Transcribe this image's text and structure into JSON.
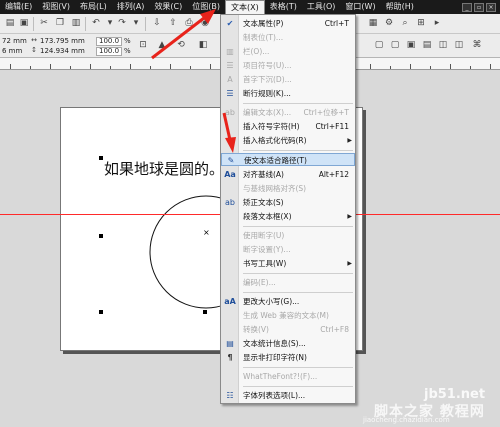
{
  "menubar": {
    "items": [
      "编辑(E)",
      "视图(V)",
      "布局(L)",
      "排列(A)",
      "效果(C)",
      "位图(B)",
      "文本(X)",
      "表格(T)",
      "工具(O)",
      "窗口(W)",
      "帮助(H)"
    ],
    "active_index": 6
  },
  "properties": {
    "pos1": "72 mm",
    "pos2": "6 mm",
    "size1": "173.795 mm",
    "size2": "124.934 mm",
    "scale1": "100.0",
    "scale2": "100.0",
    "unit": "%"
  },
  "canvas": {
    "text": "如果地球是圆的。"
  },
  "text_menu": {
    "items": [
      {
        "label": "文本属性(P)",
        "shortcut": "Ctrl+T",
        "icon": "check-icon",
        "disabled": false
      },
      {
        "label": "制表位(T)...",
        "shortcut": "",
        "icon": "",
        "disabled": true
      },
      {
        "label": "栏(O)...",
        "shortcut": "",
        "icon": "",
        "disabled": true
      },
      {
        "label": "项目符号(U)...",
        "shortcut": "",
        "icon": "",
        "disabled": true
      },
      {
        "label": "首字下沉(D)...",
        "shortcut": "",
        "icon": "",
        "disabled": true
      },
      {
        "label": "断行规则(K)...",
        "shortcut": "",
        "icon": "list-icon",
        "disabled": false
      },
      {
        "label": "编辑文本(X)...",
        "shortcut": "Ctrl+位移+T",
        "icon": "edit-text-icon",
        "disabled": true
      },
      {
        "label": "插入符号字符(H)",
        "shortcut": "Ctrl+F11",
        "icon": "",
        "disabled": false
      },
      {
        "label": "插入格式化代码(R)",
        "shortcut": "",
        "icon": "",
        "disabled": false,
        "submenu": true
      },
      {
        "label": "使文本适合路径(T)",
        "shortcut": "",
        "icon": "fit-text-path-icon",
        "disabled": false,
        "highlight": true
      },
      {
        "label": "对齐基线(A)",
        "shortcut": "Alt+F12",
        "icon": "align-baseline-icon",
        "disabled": false
      },
      {
        "label": "与基线网格对齐(S)",
        "shortcut": "",
        "icon": "",
        "disabled": true
      },
      {
        "label": "矫正文本(S)",
        "shortcut": "",
        "icon": "straighten-text-icon",
        "disabled": false
      },
      {
        "label": "段落文本框(X)",
        "shortcut": "",
        "icon": "",
        "disabled": false,
        "submenu": true
      },
      {
        "label": "使用断字(U)",
        "shortcut": "",
        "icon": "",
        "disabled": true
      },
      {
        "label": "断字设置(Y)...",
        "shortcut": "",
        "icon": "",
        "disabled": true
      },
      {
        "label": "书写工具(W)",
        "shortcut": "",
        "icon": "",
        "disabled": false,
        "submenu": true
      },
      {
        "label": "编码(E)...",
        "shortcut": "",
        "icon": "",
        "disabled": true
      },
      {
        "label": "更改大小写(G)...",
        "shortcut": "",
        "icon": "change-case-icon",
        "disabled": false
      },
      {
        "label": "生成 Web 兼容的文本(M)",
        "shortcut": "",
        "icon": "",
        "disabled": true
      },
      {
        "label": "转换(V)",
        "shortcut": "Ctrl+F8",
        "icon": "",
        "disabled": true
      },
      {
        "label": "文本统计信息(S)...",
        "shortcut": "",
        "icon": "text-stats-icon",
        "disabled": false
      },
      {
        "label": "显示非打印字符(N)",
        "shortcut": "",
        "icon": "pilcrow-icon",
        "disabled": false
      },
      {
        "label": "WhatTheFont?!(F)...",
        "shortcut": "",
        "icon": "",
        "disabled": true
      },
      {
        "label": "字体列表选项(L)...",
        "shortcut": "",
        "icon": "font-list-icon",
        "disabled": false
      }
    ]
  },
  "watermark": {
    "site": "jb51.net",
    "title": "脚本之家 教程网",
    "url": "jiaocheng.chazidian.com"
  }
}
